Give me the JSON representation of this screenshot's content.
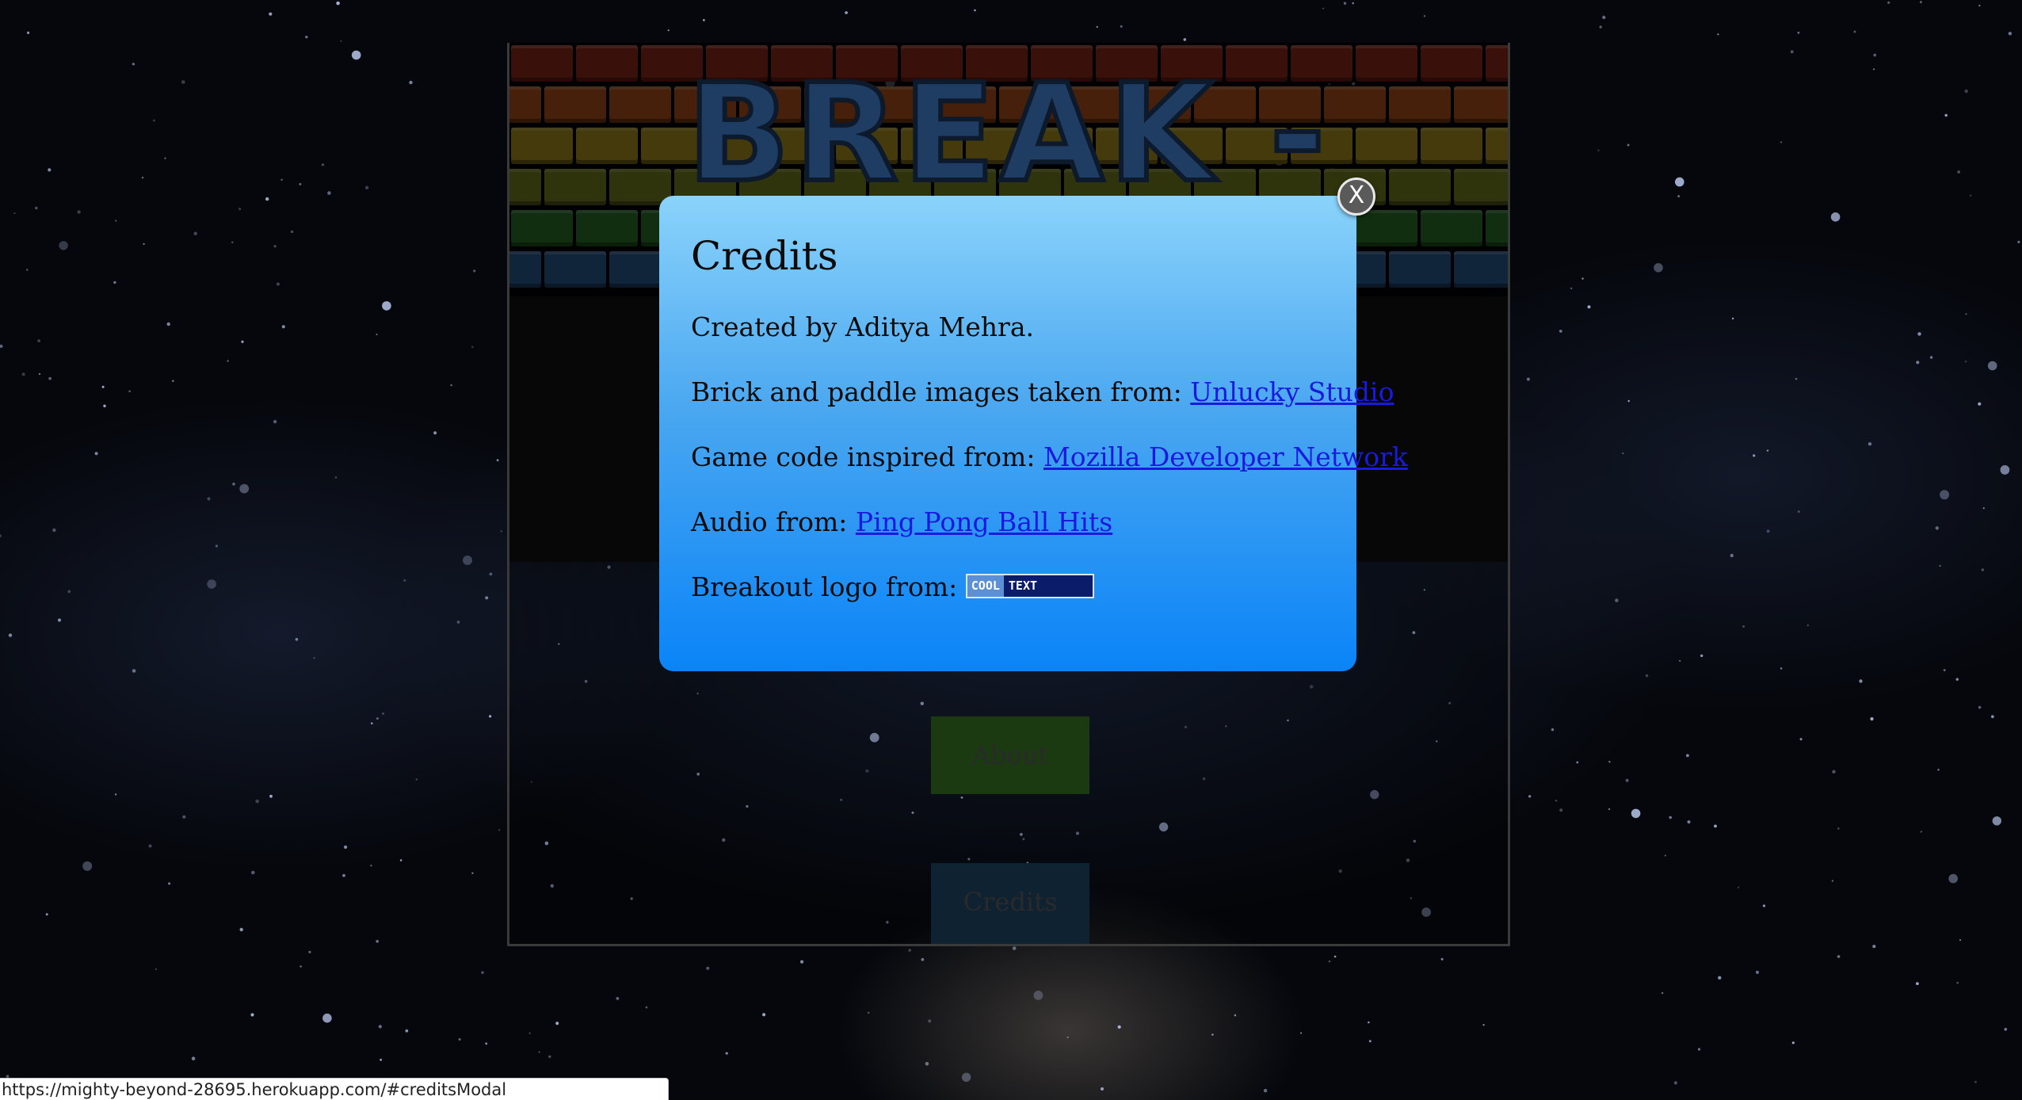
{
  "game": {
    "logo_alt": "BREAK - OUT",
    "menu": {
      "about_label": "About",
      "credits_label": "Credits"
    }
  },
  "modal": {
    "title": "Credits",
    "close_label": "X",
    "lines": {
      "created_by": "Created by Aditya Mehra.",
      "bricks_prefix": "Brick and paddle images taken from:",
      "bricks_link": "Unlucky Studio",
      "code_prefix": "Game code inspired from:",
      "code_link": "Mozilla Developer Network",
      "audio_prefix": "Audio from:",
      "audio_link": "Ping Pong Ball Hits",
      "logo_prefix": "Breakout logo from:"
    },
    "badge": {
      "cool": "COOL",
      "text": "TEXT"
    }
  },
  "status_bar": {
    "url": "https://mighty-beyond-28695.herokuapp.com/#creditsModal"
  },
  "colors": {
    "modal_top": "#8ad3fb",
    "modal_bottom": "#0a84f8",
    "link": "#1a1adf",
    "about_button": "#1c3a12",
    "credits_button": "#0f2231"
  }
}
